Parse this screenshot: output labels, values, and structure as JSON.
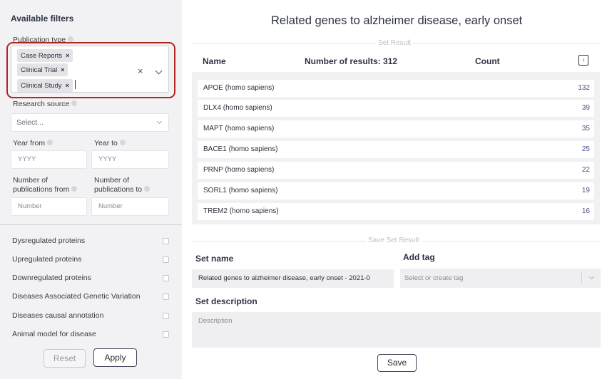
{
  "sidebar": {
    "title": "Available filters",
    "publication_type": {
      "label": "Publication type",
      "chips": [
        "Case Reports",
        "Clinical Trial",
        "Clinical Study"
      ],
      "chip_remove": "×",
      "clear": "×"
    },
    "research_source": {
      "label": "Research source",
      "placeholder": "Select..."
    },
    "year_from": {
      "label": "Year from",
      "placeholder": "YYYY"
    },
    "year_to": {
      "label": "Year to",
      "placeholder": "YYYY"
    },
    "pubs_from": {
      "label_line1": "Number of",
      "label_line2": "publications from",
      "placeholder": "Number"
    },
    "pubs_to": {
      "label_line1": "Number of",
      "label_line2": "publications to",
      "placeholder": "Number"
    },
    "checkboxes": [
      "Dysregulated proteins",
      "Upregulated proteins",
      "Downregulated proteins",
      "Diseases Associated Genetic Variation",
      "Diseases causal annotation",
      "Animal model for disease"
    ],
    "reset_label": "Reset",
    "apply_label": "Apply"
  },
  "main": {
    "title": "Related genes to alzheimer disease, early onset",
    "set_result_label": "Set Result",
    "headers": {
      "name": "Name",
      "results": "Number of results: 312",
      "count": "Count"
    },
    "rows": [
      {
        "name": "APOE (homo sapiens)",
        "count": "132"
      },
      {
        "name": "DLX4 (homo sapiens)",
        "count": "39"
      },
      {
        "name": "MAPT (homo sapiens)",
        "count": "35"
      },
      {
        "name": "BACE1 (homo sapiens)",
        "count": "25"
      },
      {
        "name": "PRNP (homo sapiens)",
        "count": "22"
      },
      {
        "name": "SORL1 (homo sapiens)",
        "count": "19"
      },
      {
        "name": "TREM2 (homo sapiens)",
        "count": "16"
      }
    ],
    "save_section_label": "Save Set Result",
    "set_name_label": "Set name",
    "set_name_value": "Related genes to alzheimer disease, early onset - 2021-0",
    "add_tag_label": "Add tag",
    "tag_placeholder": "Select or create tag",
    "set_description_label": "Set description",
    "description_placeholder": "Description",
    "save_label": "Save"
  }
}
